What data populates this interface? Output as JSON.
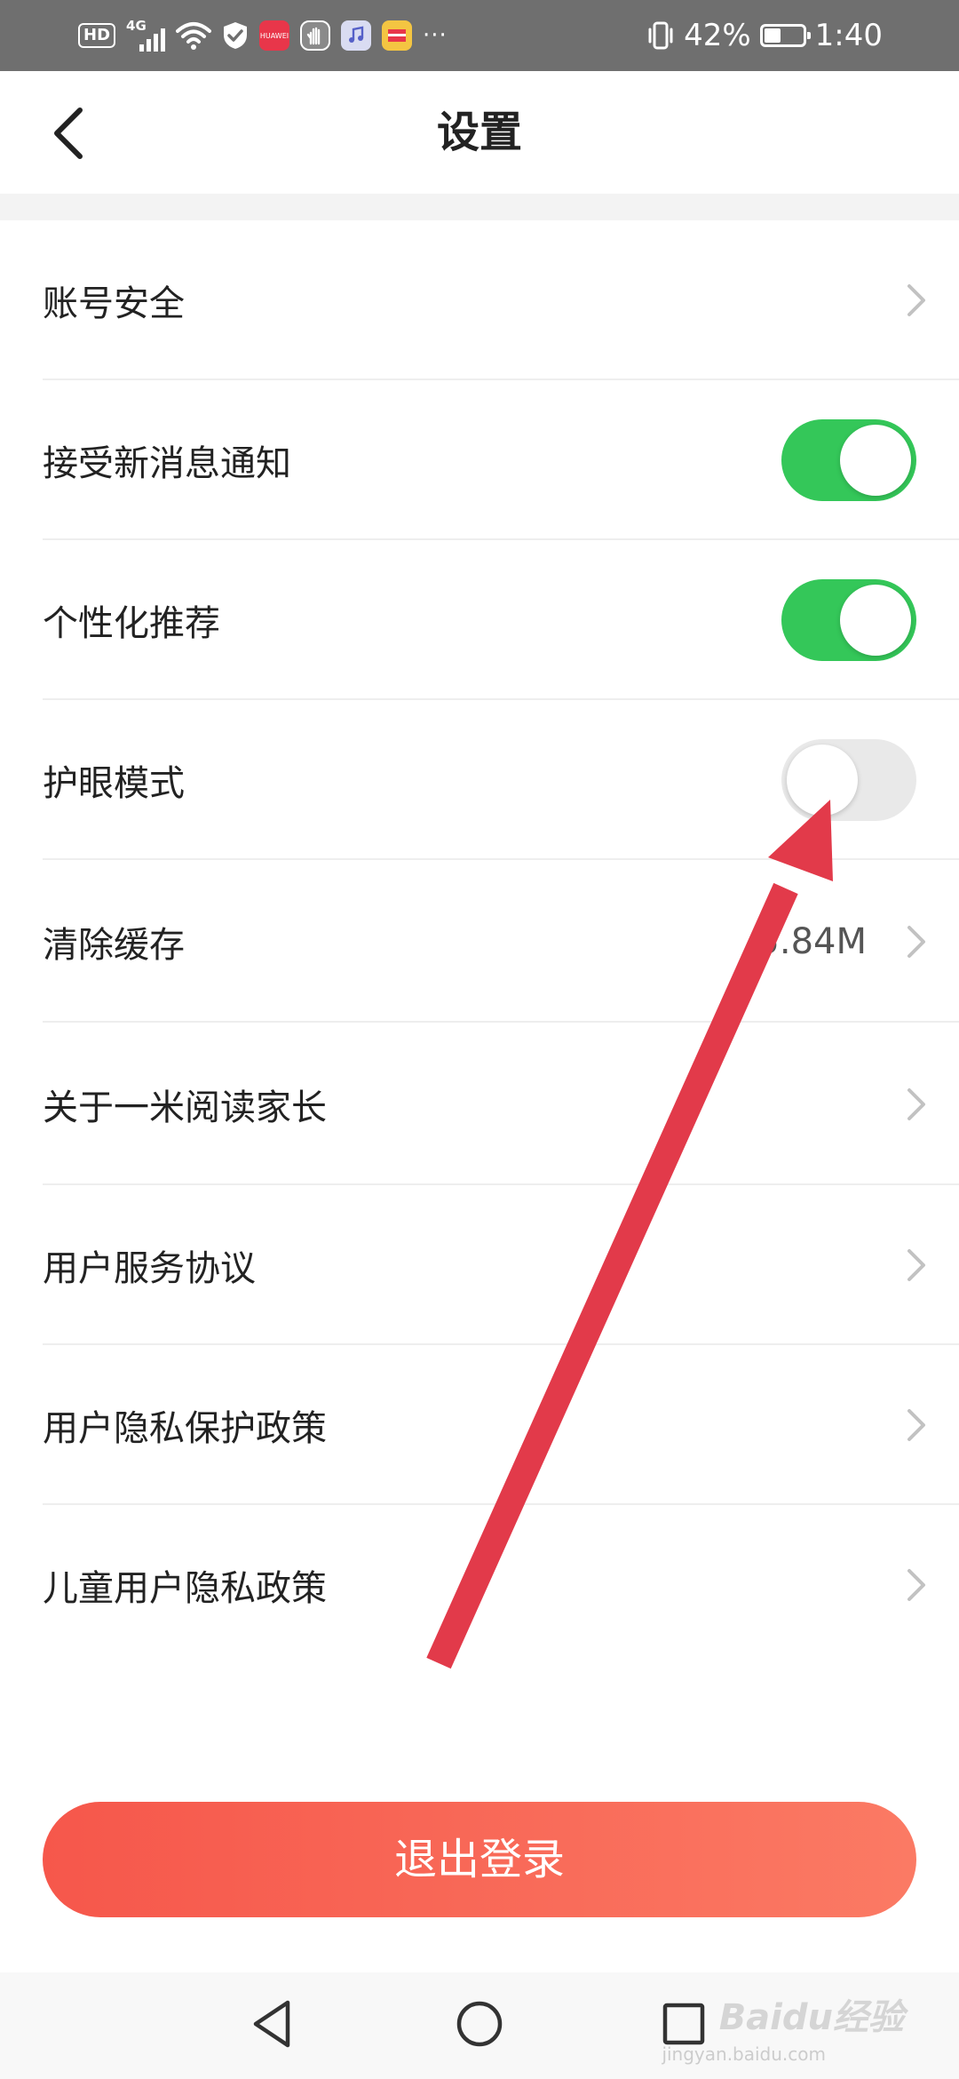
{
  "status_bar": {
    "hd_badge": "HD",
    "network": "4G",
    "huawei_app": "HUAWEI",
    "more": "···",
    "battery_percent": "42%",
    "battery_level": 0.42,
    "time": "1:40"
  },
  "header": {
    "title": "设置"
  },
  "settings": {
    "items": [
      {
        "label": "账号安全",
        "control": "chevron"
      },
      {
        "label": "接受新消息通知",
        "control": "toggle",
        "on": true
      },
      {
        "label": "个性化推荐",
        "control": "toggle",
        "on": true
      },
      {
        "label": "护眼模式",
        "control": "toggle",
        "on": false
      },
      {
        "label": "清除缓存",
        "control": "chevron",
        "value": "5.84M"
      },
      {
        "label": "关于一米阅读家长",
        "control": "chevron"
      },
      {
        "label": "用户服务协议",
        "control": "chevron"
      },
      {
        "label": "用户隐私保护政策",
        "control": "chevron"
      },
      {
        "label": "儿童用户隐私政策",
        "control": "chevron"
      }
    ]
  },
  "logout": {
    "label": "退出登录"
  },
  "watermark": {
    "brand": "Baidu经验",
    "domain": "jingyan.baidu.com"
  },
  "colors": {
    "toggle_on": "#34c759",
    "toggle_off": "#e9e9e9",
    "logout_start": "#f6574b",
    "logout_end": "#fb7a64",
    "annotation_arrow": "#e23a4a"
  },
  "icons": {
    "back": "chevron-left-icon",
    "row_arrow": "chevron-right-icon",
    "nav_back": "triangle-back-icon",
    "nav_home": "circle-home-icon",
    "nav_recent": "square-recent-icon"
  }
}
